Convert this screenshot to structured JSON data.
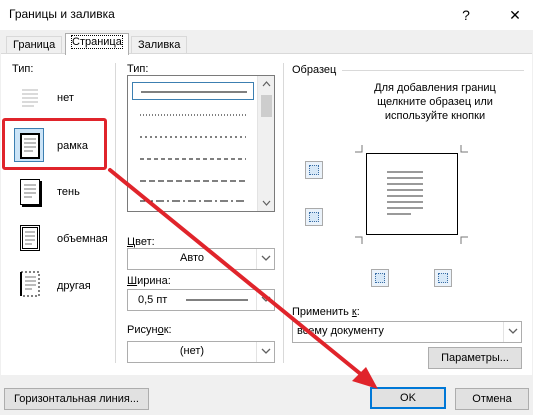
{
  "window": {
    "title": "Границы и заливка",
    "help_glyph": "?",
    "close_glyph": "✕"
  },
  "tabs": [
    {
      "label": "Граница",
      "active": false
    },
    {
      "label": "Страница",
      "active": true
    },
    {
      "label": "Заливка",
      "active": false
    }
  ],
  "setting": {
    "label": "Тип:",
    "types": [
      {
        "label": "нет",
        "icon": "none-border-icon",
        "selected": false
      },
      {
        "label": "рамка",
        "icon": "box-border-icon",
        "selected": true
      },
      {
        "label": "тень",
        "icon": "shadow-border-icon",
        "selected": false
      },
      {
        "label": "объемная",
        "icon": "3d-border-icon",
        "selected": false
      },
      {
        "label": "другая",
        "icon": "custom-border-icon",
        "selected": false
      }
    ]
  },
  "style": {
    "label": "Тип:",
    "line_styles": [
      "solid",
      "dotted",
      "dash-dot-fine",
      "dashed",
      "dash-long",
      "dash-dot"
    ],
    "selected_index": 0
  },
  "color": {
    "label": "Цвет:",
    "value": "Авто"
  },
  "width": {
    "label": "Ширина:",
    "value": "0,5 пт"
  },
  "art": {
    "label": "Рисунок:",
    "value": "(нет)"
  },
  "preview": {
    "label": "Образец",
    "hint_line1": "Для добавления границ",
    "hint_line2": "щелкните образец или",
    "hint_line3": "используйте кнопки"
  },
  "apply_to": {
    "label": "Применить к:",
    "value": "всему документу"
  },
  "buttons": {
    "options": "Параметры...",
    "horizontal_line": "Горизонтальная линия...",
    "ok": "OK",
    "cancel": "Отмена"
  },
  "colors": {
    "accent": "#0078d7",
    "highlight_red": "#e0242b",
    "selection": "#cce4f7"
  }
}
